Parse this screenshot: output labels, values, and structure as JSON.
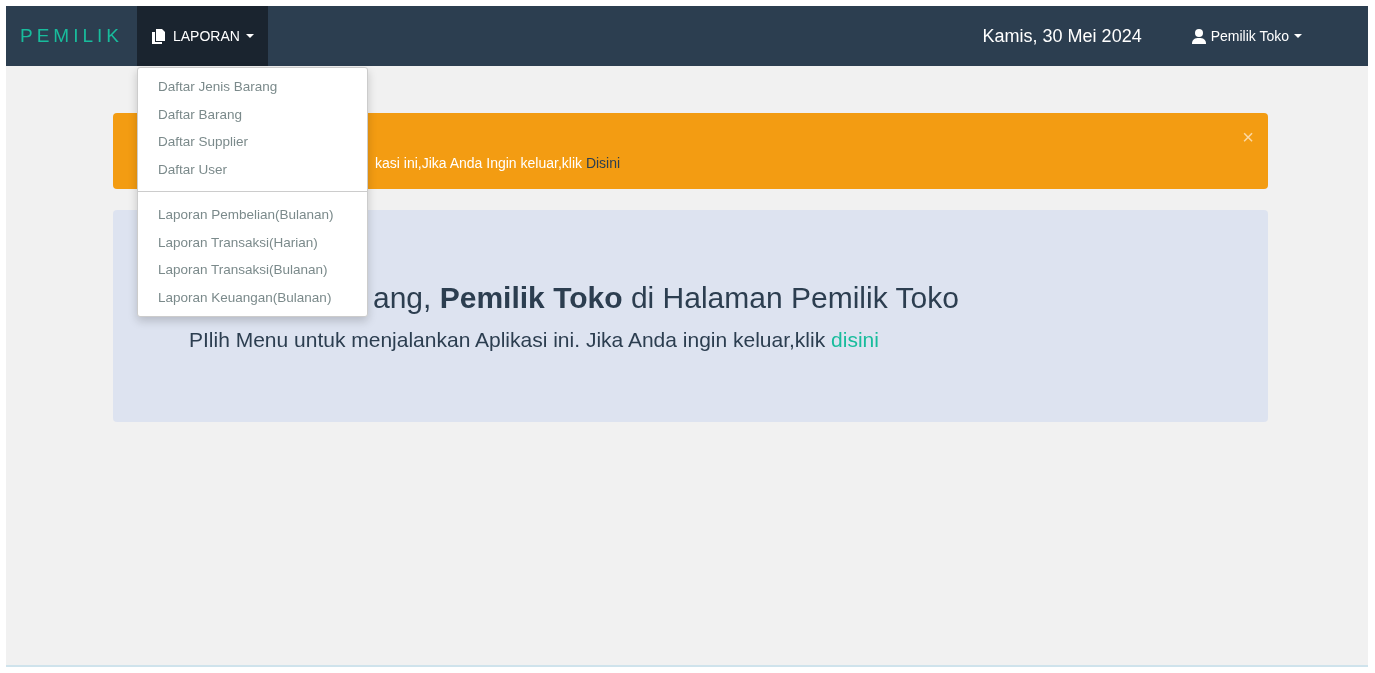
{
  "navbar": {
    "brand": "PEMILIK",
    "menu": {
      "label": "LAPORAN",
      "expanded": true,
      "groups": [
        {
          "items": [
            "Daftar Jenis Barang",
            "Daftar Barang",
            "Daftar Supplier",
            "Daftar User"
          ]
        },
        {
          "items": [
            "Laporan Pembelian(Bulanan)",
            "Laporan Transaksi(Harian)",
            "Laporan Transaksi(Bulanan)",
            "Laporan Keuangan(Bulanan)"
          ]
        }
      ]
    },
    "date": "Kamis, 30 Mei 2024",
    "user": "Pemilik Toko"
  },
  "alert": {
    "text": "kasi ini,Jika Anda Ingin keluar,klik",
    "link": "Disini",
    "close": "×"
  },
  "jumbotron": {
    "heading": "ang, **Pemilik Toko** di Halaman Pemilik Toko",
    "text": "PIlih Menu untuk menjalankan Aplikasi ini. Jika Anda ingin keluar,klik",
    "link": "disini"
  }
}
